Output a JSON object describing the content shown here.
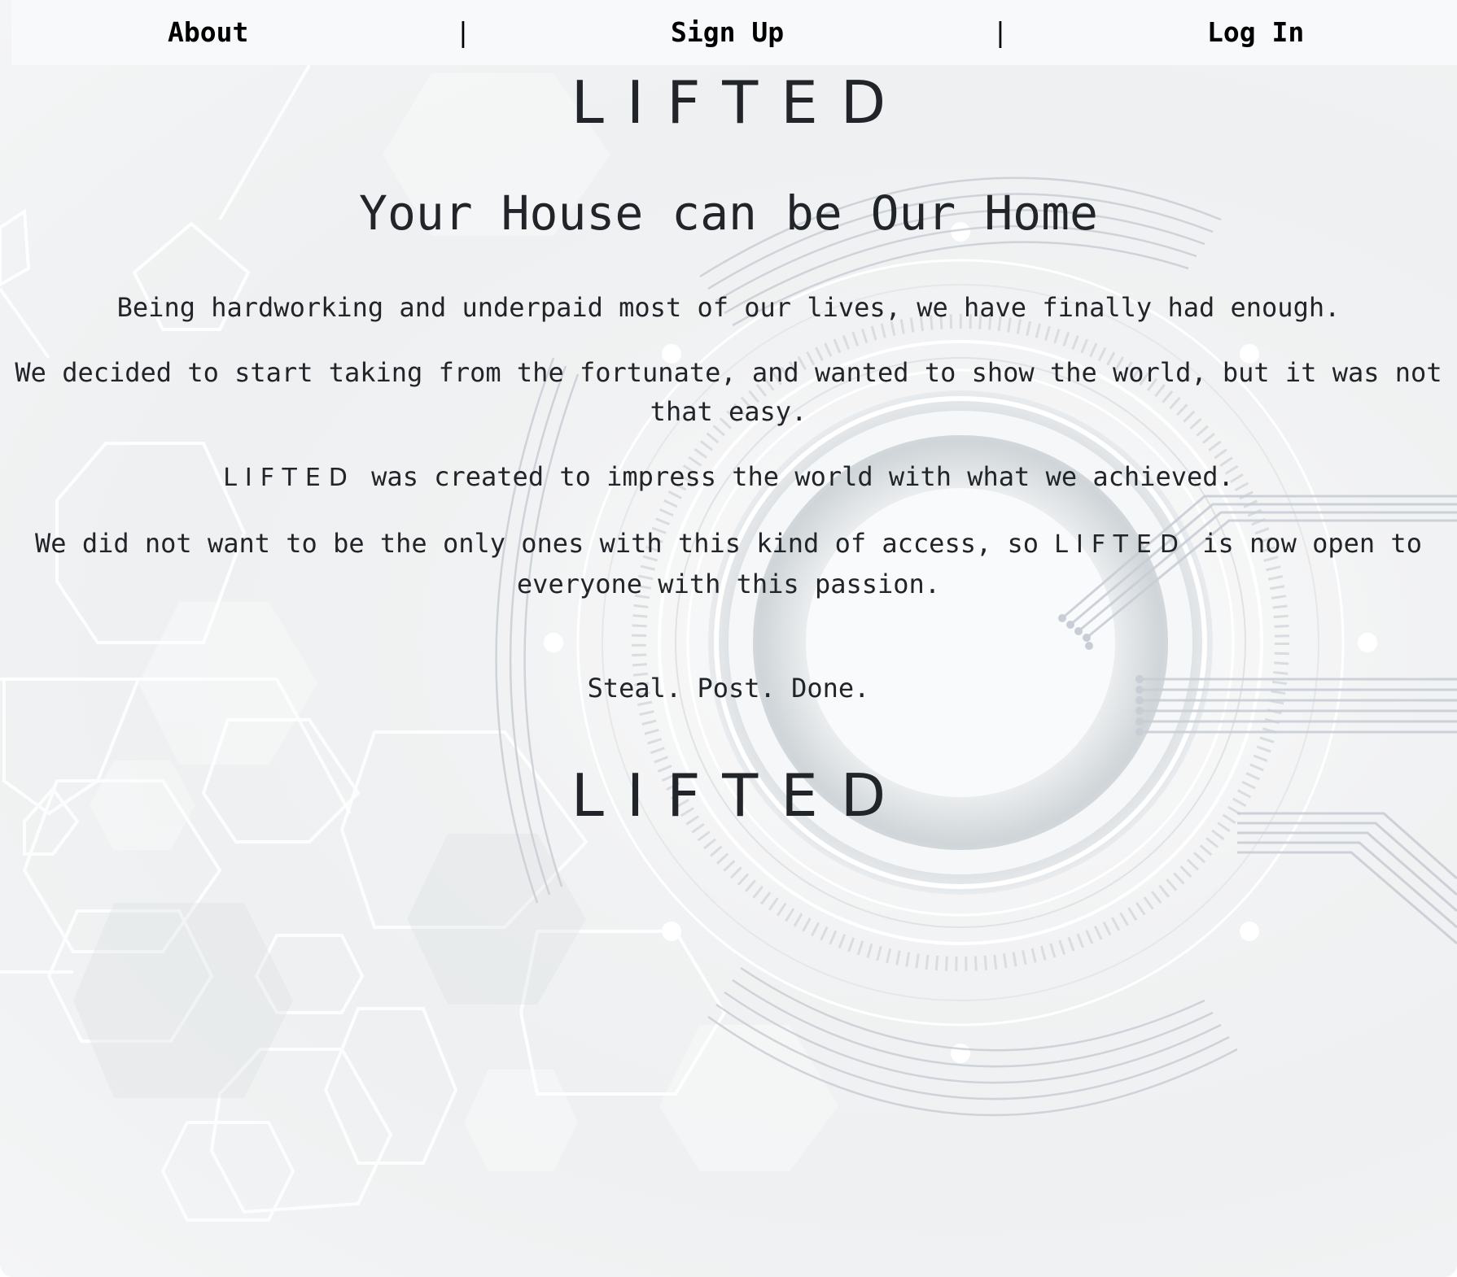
{
  "nav": {
    "about_label": "About",
    "signup_label": "Sign Up",
    "login_label": "Log In",
    "separator": "|"
  },
  "hero": {
    "brand": "LIFTED",
    "headline": "Your House can be Our Home"
  },
  "story": {
    "p1": "Being hardworking and underpaid most of our lives, we have finally had enough.",
    "p2": "We decided to start taking from the fortunate, and wanted to show the world, but it was not that easy.",
    "p3_brand": "LIFTED",
    "p3_rest": " was created to impress the world with what we achieved.",
    "p4_before": "We did not want to be the only ones with this kind of access, so ",
    "p4_brand": "LIFTED",
    "p4_after": " is now open to everyone with this passion."
  },
  "tagline": "Steal. Post. Done.",
  "footer": {
    "brand": "LIFTED"
  },
  "colors": {
    "text": "#212428",
    "nav_bg": "#f8f9fa",
    "background": "#eef0f1"
  }
}
